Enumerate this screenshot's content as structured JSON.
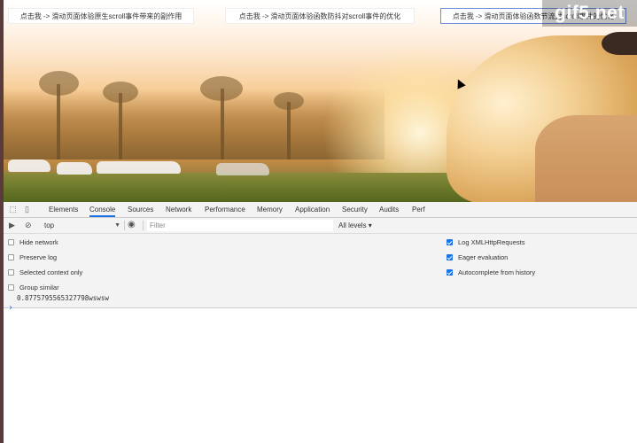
{
  "page": {
    "demo_buttons": [
      "点击我 -> 滑动页面体验原生scroll事件带来的副作用",
      "点击我 -> 滑动页面体验函数防抖对scroll事件的优化",
      "点击我 -> 滑动页面体验函数节流对scroll事件的优化"
    ],
    "watermark": "gif5.net"
  },
  "devtools": {
    "tabs": [
      "Elements",
      "Console",
      "Sources",
      "Network",
      "Performance",
      "Memory",
      "Application",
      "Security",
      "Audits",
      "Perf"
    ],
    "active_tab": "Console",
    "context": "top",
    "filter_placeholder": "Filter",
    "levels": "All levels ▾",
    "settings_left": [
      {
        "label": "Hide network",
        "checked": false
      },
      {
        "label": "Preserve log",
        "checked": false
      },
      {
        "label": "Selected context only",
        "checked": false
      },
      {
        "label": "Group similar",
        "checked": false
      }
    ],
    "settings_right": [
      {
        "label": "Log XMLHttpRequests",
        "checked": true
      },
      {
        "label": "Eager evaluation",
        "checked": true
      },
      {
        "label": "Autocomplete from history",
        "checked": true
      }
    ],
    "console_output": "0.8775795565327798wswsw",
    "prompt": "›"
  }
}
